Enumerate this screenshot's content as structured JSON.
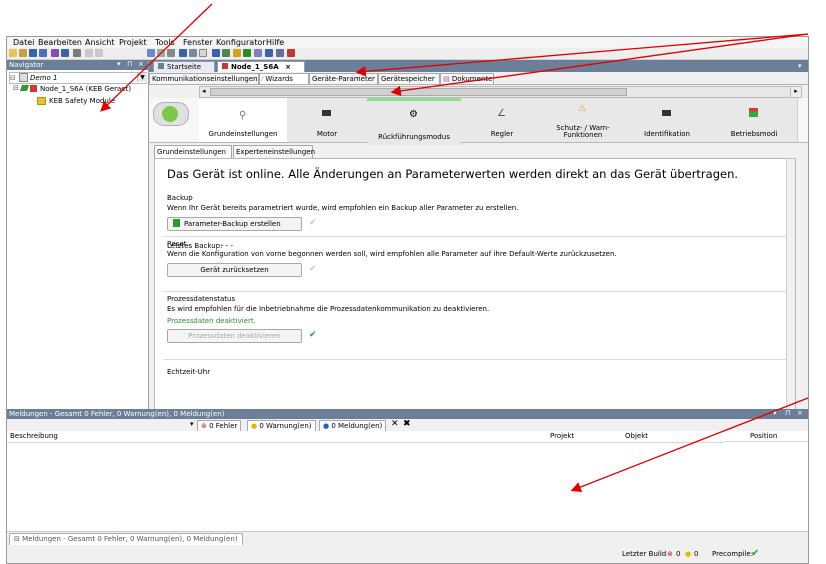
{
  "menu": [
    "Datei",
    "Bearbeiten",
    "Ansicht",
    "Projekt",
    "Tools",
    "Fenster",
    "Konfigurator",
    "Hilfe"
  ],
  "navigator": {
    "title": "Navigator",
    "tree": [
      "Demo 1",
      "Node_1_S6A (KEB Geraet)",
      "KEB Safety Module"
    ]
  },
  "doc_tabs": [
    "Startseite",
    "Node_1_S6A"
  ],
  "sub_tabs": [
    "Kommunikationseinstellungen",
    "Wizards",
    "Geräte-Parameter",
    "Gerätespeicher",
    "Dokumente"
  ],
  "wizard_steps": [
    "Grundeinstellungen",
    "Motor",
    "Rückführungsmodus",
    "Regler",
    "Schutz- / Warn-\nFunktionen",
    "Identifikation",
    "Betriebsmodi"
  ],
  "inner_tabs": [
    "Grundeinstellungen",
    "Experteneinstellungen"
  ],
  "main": {
    "headline": "Das Gerät ist online. Alle Änderungen an Parameterwerten werden direkt an das Gerät übertragen.",
    "backup": {
      "title": "Backup",
      "desc": "Wenn Ihr Gerät bereits parametriert wurde, wird empfohlen ein Backup aller Parameter zu erstellen.",
      "button": "Parameter-Backup erstellen",
      "last_label": "Letztes Backup:",
      "last_value": "- - -"
    },
    "reset": {
      "title": "Reset",
      "desc": "Wenn die Konfiguration von vorne begonnen werden soll, wird empfohlen alle Parameter auf ihre Default-Werte zurückzusetzen.",
      "button": "Gerät zurücksetzen"
    },
    "pd": {
      "title": "Prozessdatenstatus",
      "desc": "Es wird empfohlen für die Inbetriebnahme die Prozessdatenkommunikation zu deaktivieren.",
      "status": "Prozessdaten deaktiviert.",
      "button": "Prozessdaten deaktivieren"
    },
    "rtc": {
      "title": "Echtzeit-Uhr"
    }
  },
  "messages": {
    "title": "Meldungen - Gesamt 0 Fehler, 0 Warnung(en), 0 Meldung(en)",
    "filters": [
      "0 Fehler",
      "0 Warnung(en)",
      "0 Meldung(en)"
    ],
    "columns": [
      "Beschreibung",
      "Projekt",
      "Objekt",
      "Position"
    ],
    "bottom_tab": "Meldungen - Gesamt 0 Fehler, 0 Warnung(en), 0 Meldung(en)"
  },
  "status": {
    "build_label": "Letzter Build",
    "build_errors": "0",
    "build_warnings": "0",
    "precompile_label": "Precompile:"
  },
  "colors": {
    "accent": "#6b7f99",
    "annotation": "#e00000",
    "ok": "#2e9a2e",
    "error": "#d81e1e",
    "warn": "#e6b800",
    "info": "#1f5fbf"
  }
}
